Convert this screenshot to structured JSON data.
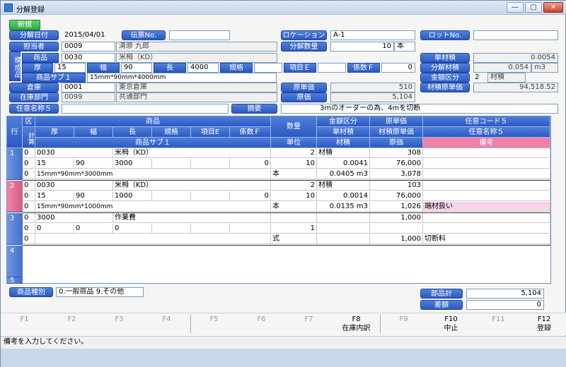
{
  "window": {
    "title": "分解登録",
    "minimize": "—",
    "maximize": "▢",
    "close": "✕"
  },
  "toolbar": {
    "new_label": "新規"
  },
  "header": {
    "date_label": "分解日付",
    "date_value": "2015/04/01",
    "slip_label": "伝票No.",
    "slip_value": "",
    "location_label": "ロケーション",
    "location_value": "A-1",
    "lot_label": "ロットNo.",
    "lot_value": "",
    "staff_label": "担当者",
    "staff_code": "0009",
    "staff_name": "清原 九郎",
    "qty_label": "分解数量",
    "qty_value": "10",
    "qty_unit": "本",
    "composition_label": "構成品",
    "product_label": "商品",
    "product_code": "0030",
    "product_name": "米栂（KD）",
    "unit_volume_label": "単材積",
    "unit_volume_value": "0.0054",
    "thick_label": "厚",
    "thick_value": "15",
    "width_label": "幅",
    "width_value": "90",
    "length_label": "長",
    "length_value": "4000",
    "spec_label": "規格",
    "spec_value": "",
    "itemE_label": "項目Ｅ",
    "itemE_value": "",
    "coefF_label": "係数Ｆ",
    "coefF_value": "0",
    "split_volume_label": "分解材積",
    "split_volume_value": "0.054",
    "split_volume_unit": "m3",
    "sub1_label": "商品サブ１",
    "sub1_value": "15mm*90mm*4000mm",
    "amount_div_label": "金額区分",
    "amount_div_code": "2",
    "amount_div_name": "材積",
    "warehouse_label": "倉庫",
    "warehouse_code": "0001",
    "warehouse_name": "東京倉庫",
    "cost_unit_label": "原単価",
    "cost_unit_value": "510",
    "volume_cost_label": "材積原単価",
    "volume_cost_value": "94,518.52",
    "dept_label": "在庫部門",
    "dept_code": "0099",
    "dept_name": "共通部門",
    "cost_label": "原価",
    "cost_value": "5,104",
    "name5_label": "任意名称５",
    "name5_value": "",
    "summary_label": "摘要",
    "summary_value": "3mのオーダーの為、4mを切断"
  },
  "grid": {
    "head_row": "行",
    "head_div": "区",
    "head_calc": "計算",
    "head_product": "商品",
    "head_thick": "厚",
    "head_width": "幅",
    "head_length": "長",
    "head_spec": "規格",
    "head_itemE": "項目E",
    "head_coefF": "係数Ｆ",
    "head_sub1": "商品サブ１",
    "head_qty": "数量",
    "head_unit": "単位",
    "head_amountdiv": "金額区分",
    "head_unitvol": "単材積",
    "head_volume": "材積",
    "head_costunit": "原単価",
    "head_volcost": "材積原単価",
    "head_cost": "原価",
    "head_code5": "任意コード５",
    "head_name5": "任意名称５",
    "head_note": "備考",
    "rows": [
      {
        "no": "1",
        "div": "0",
        "code": "0030",
        "name": "米栂（KD）",
        "div2": "0",
        "thick": "15",
        "width": "90",
        "length": "3000",
        "coef": "0",
        "div3": "0",
        "sub1": "15mm*90mm*3000mm",
        "qty": "10",
        "unit": "本",
        "amtdiv": "2",
        "amtdivname": "材積",
        "unitvol": "0.0041",
        "volume": "0.0405 m3",
        "costunit": "308",
        "volcost": "76,000",
        "cost": "3,078",
        "note": ""
      },
      {
        "no": "2",
        "div": "0",
        "code": "0030",
        "name": "米栂（KD）",
        "div2": "0",
        "thick": "15",
        "width": "90",
        "length": "1000",
        "coef": "0",
        "div3": "0",
        "sub1": "15mm*90mm*1000mm",
        "qty": "10",
        "unit": "本",
        "amtdiv": "2",
        "amtdivname": "材積",
        "unitvol": "0.0014",
        "volume": "0.0135 m3",
        "costunit": "103",
        "volcost": "76,000",
        "cost": "1,026",
        "note": "端材扱い"
      },
      {
        "no": "3",
        "div": "0",
        "code": "3000",
        "name": "作業費",
        "div2": "0",
        "thick": "0",
        "width": "0",
        "length": "0",
        "coef": "",
        "div3": "0",
        "sub1": "",
        "qty": "1",
        "unit": "式",
        "amtdiv": "",
        "amtdivname": "",
        "unitvol": "",
        "volume": "",
        "costunit": "1,000",
        "volcost": "",
        "cost": "1,000",
        "note": "切断料"
      }
    ],
    "empty_rows": [
      "4",
      "5"
    ]
  },
  "footer": {
    "kind_label": "商品種別",
    "kind_value": "0.一般商品 9.その他",
    "parts_total_label": "部品計",
    "parts_total_value": "5,104",
    "diff_label": "差額",
    "diff_value": "0"
  },
  "fkeys": [
    {
      "key": "F1",
      "label": ""
    },
    {
      "key": "F2",
      "label": ""
    },
    {
      "key": "F3",
      "label": ""
    },
    {
      "key": "F4",
      "label": ""
    },
    {
      "key": "F5",
      "label": ""
    },
    {
      "key": "F6",
      "label": ""
    },
    {
      "key": "F7",
      "label": ""
    },
    {
      "key": "F8",
      "label": "在庫内訳"
    },
    {
      "key": "F9",
      "label": ""
    },
    {
      "key": "F10",
      "label": "中止"
    },
    {
      "key": "F11",
      "label": ""
    },
    {
      "key": "F12",
      "label": "登録"
    }
  ],
  "status": "備考を入力してください。"
}
